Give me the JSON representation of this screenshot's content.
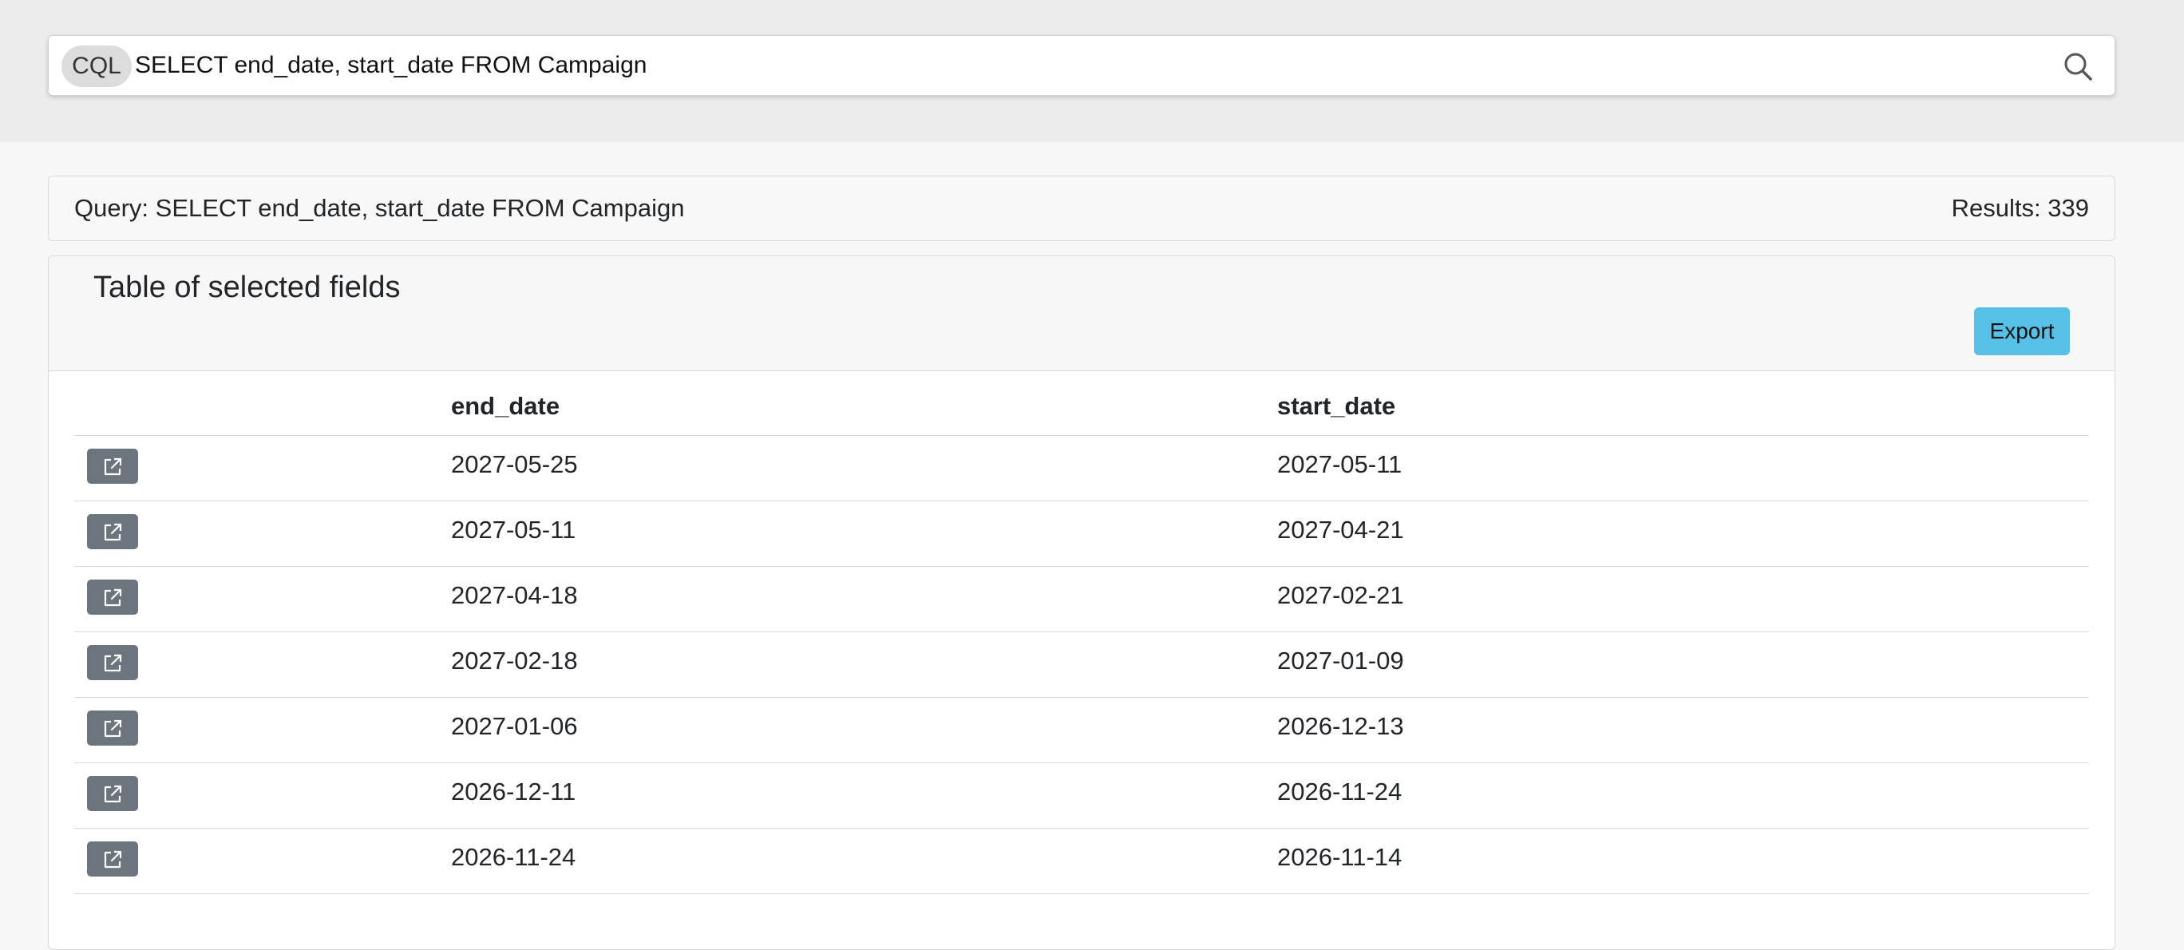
{
  "search": {
    "language_badge": "CQL",
    "query_value": "SELECT end_date, start_date FROM Campaign",
    "icon": "search-icon"
  },
  "summary": {
    "query_label": "Query: SELECT end_date, start_date FROM Campaign",
    "results_label": "Results: 339"
  },
  "table_card": {
    "title": "Table of selected fields",
    "export_label": "Export",
    "columns": [
      "",
      "end_date",
      "start_date"
    ],
    "row_icon": "external-link-icon",
    "rows": [
      {
        "end_date": "2027-05-25",
        "start_date": "2027-05-11"
      },
      {
        "end_date": "2027-05-11",
        "start_date": "2027-04-21"
      },
      {
        "end_date": "2027-04-18",
        "start_date": "2027-02-21"
      },
      {
        "end_date": "2027-02-18",
        "start_date": "2027-01-09"
      },
      {
        "end_date": "2027-01-06",
        "start_date": "2026-12-13"
      },
      {
        "end_date": "2026-12-11",
        "start_date": "2026-11-24"
      },
      {
        "end_date": "2026-11-24",
        "start_date": "2026-11-14"
      }
    ]
  },
  "colors": {
    "export_button": "#56c0e6",
    "row_button": "#6c757d"
  }
}
